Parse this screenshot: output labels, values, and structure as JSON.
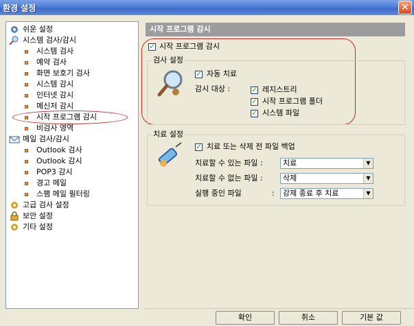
{
  "window": {
    "title": "환경 설정",
    "close_glyph": "✕"
  },
  "tree": {
    "items": [
      {
        "label": "쉬운 설정",
        "icon": "gear-icon",
        "level": 0
      },
      {
        "label": "시스템 검사/감시",
        "icon": "magnifier-icon",
        "level": 0
      },
      {
        "label": "시스템 검사",
        "level": 1
      },
      {
        "label": "예약 검사",
        "level": 1
      },
      {
        "label": "화면 보호기 검사",
        "level": 1
      },
      {
        "label": "시스템 감시",
        "level": 1
      },
      {
        "label": "인터넷 감시",
        "level": 1
      },
      {
        "label": "메신저 감시",
        "level": 1
      },
      {
        "label": "시작 프로그램 감시",
        "level": 1,
        "selected": true
      },
      {
        "label": "비검사 영역",
        "level": 1
      },
      {
        "label": "메일 검사/감시",
        "icon": "mail-icon",
        "level": 0
      },
      {
        "label": "Outlook 검사",
        "level": 1
      },
      {
        "label": "Outlook 감시",
        "level": 1
      },
      {
        "label": "POP3 감시",
        "level": 1
      },
      {
        "label": "경고 메일",
        "level": 1
      },
      {
        "label": "스팸 메일 필터링",
        "level": 1
      },
      {
        "label": "고급 검사 설정",
        "icon": "gear-icon",
        "level": 0
      },
      {
        "label": "보안 설정",
        "icon": "lock-icon",
        "level": 0
      },
      {
        "label": "기타 설정",
        "icon": "gear-icon",
        "level": 0
      }
    ]
  },
  "panel": {
    "header": "시작 프로그램 감시",
    "main_checkbox": {
      "label": "시작 프로그램 감시",
      "checked": true
    },
    "scan": {
      "title": "검사 설정",
      "auto_treat": {
        "label": "자동 치료",
        "checked": true
      },
      "target_label": "감시 대상 :",
      "targets": [
        {
          "label": "레지스트리",
          "checked": true
        },
        {
          "label": "시작 프로그램 폴더",
          "checked": true
        },
        {
          "label": "시스템 파일",
          "checked": true
        }
      ]
    },
    "treat": {
      "title": "치료 설정",
      "backup": {
        "label": "치료 또는 삭제 전 파일 백업",
        "checked": true
      },
      "rows": [
        {
          "label": "치료할 수 있는 파일 :",
          "value": "치료"
        },
        {
          "label": "치료할 수 없는 파일 :",
          "value": "삭제"
        },
        {
          "label": "실행 중인 파일",
          "colon": ":",
          "value": "강제 종료 후 치료"
        }
      ]
    }
  },
  "buttons": {
    "ok": "확인",
    "cancel": "취소",
    "default": "기본 값"
  },
  "colors": {
    "accent": "#3d6cc7",
    "highlight_ring": "#c62828",
    "check": "#21a121"
  }
}
